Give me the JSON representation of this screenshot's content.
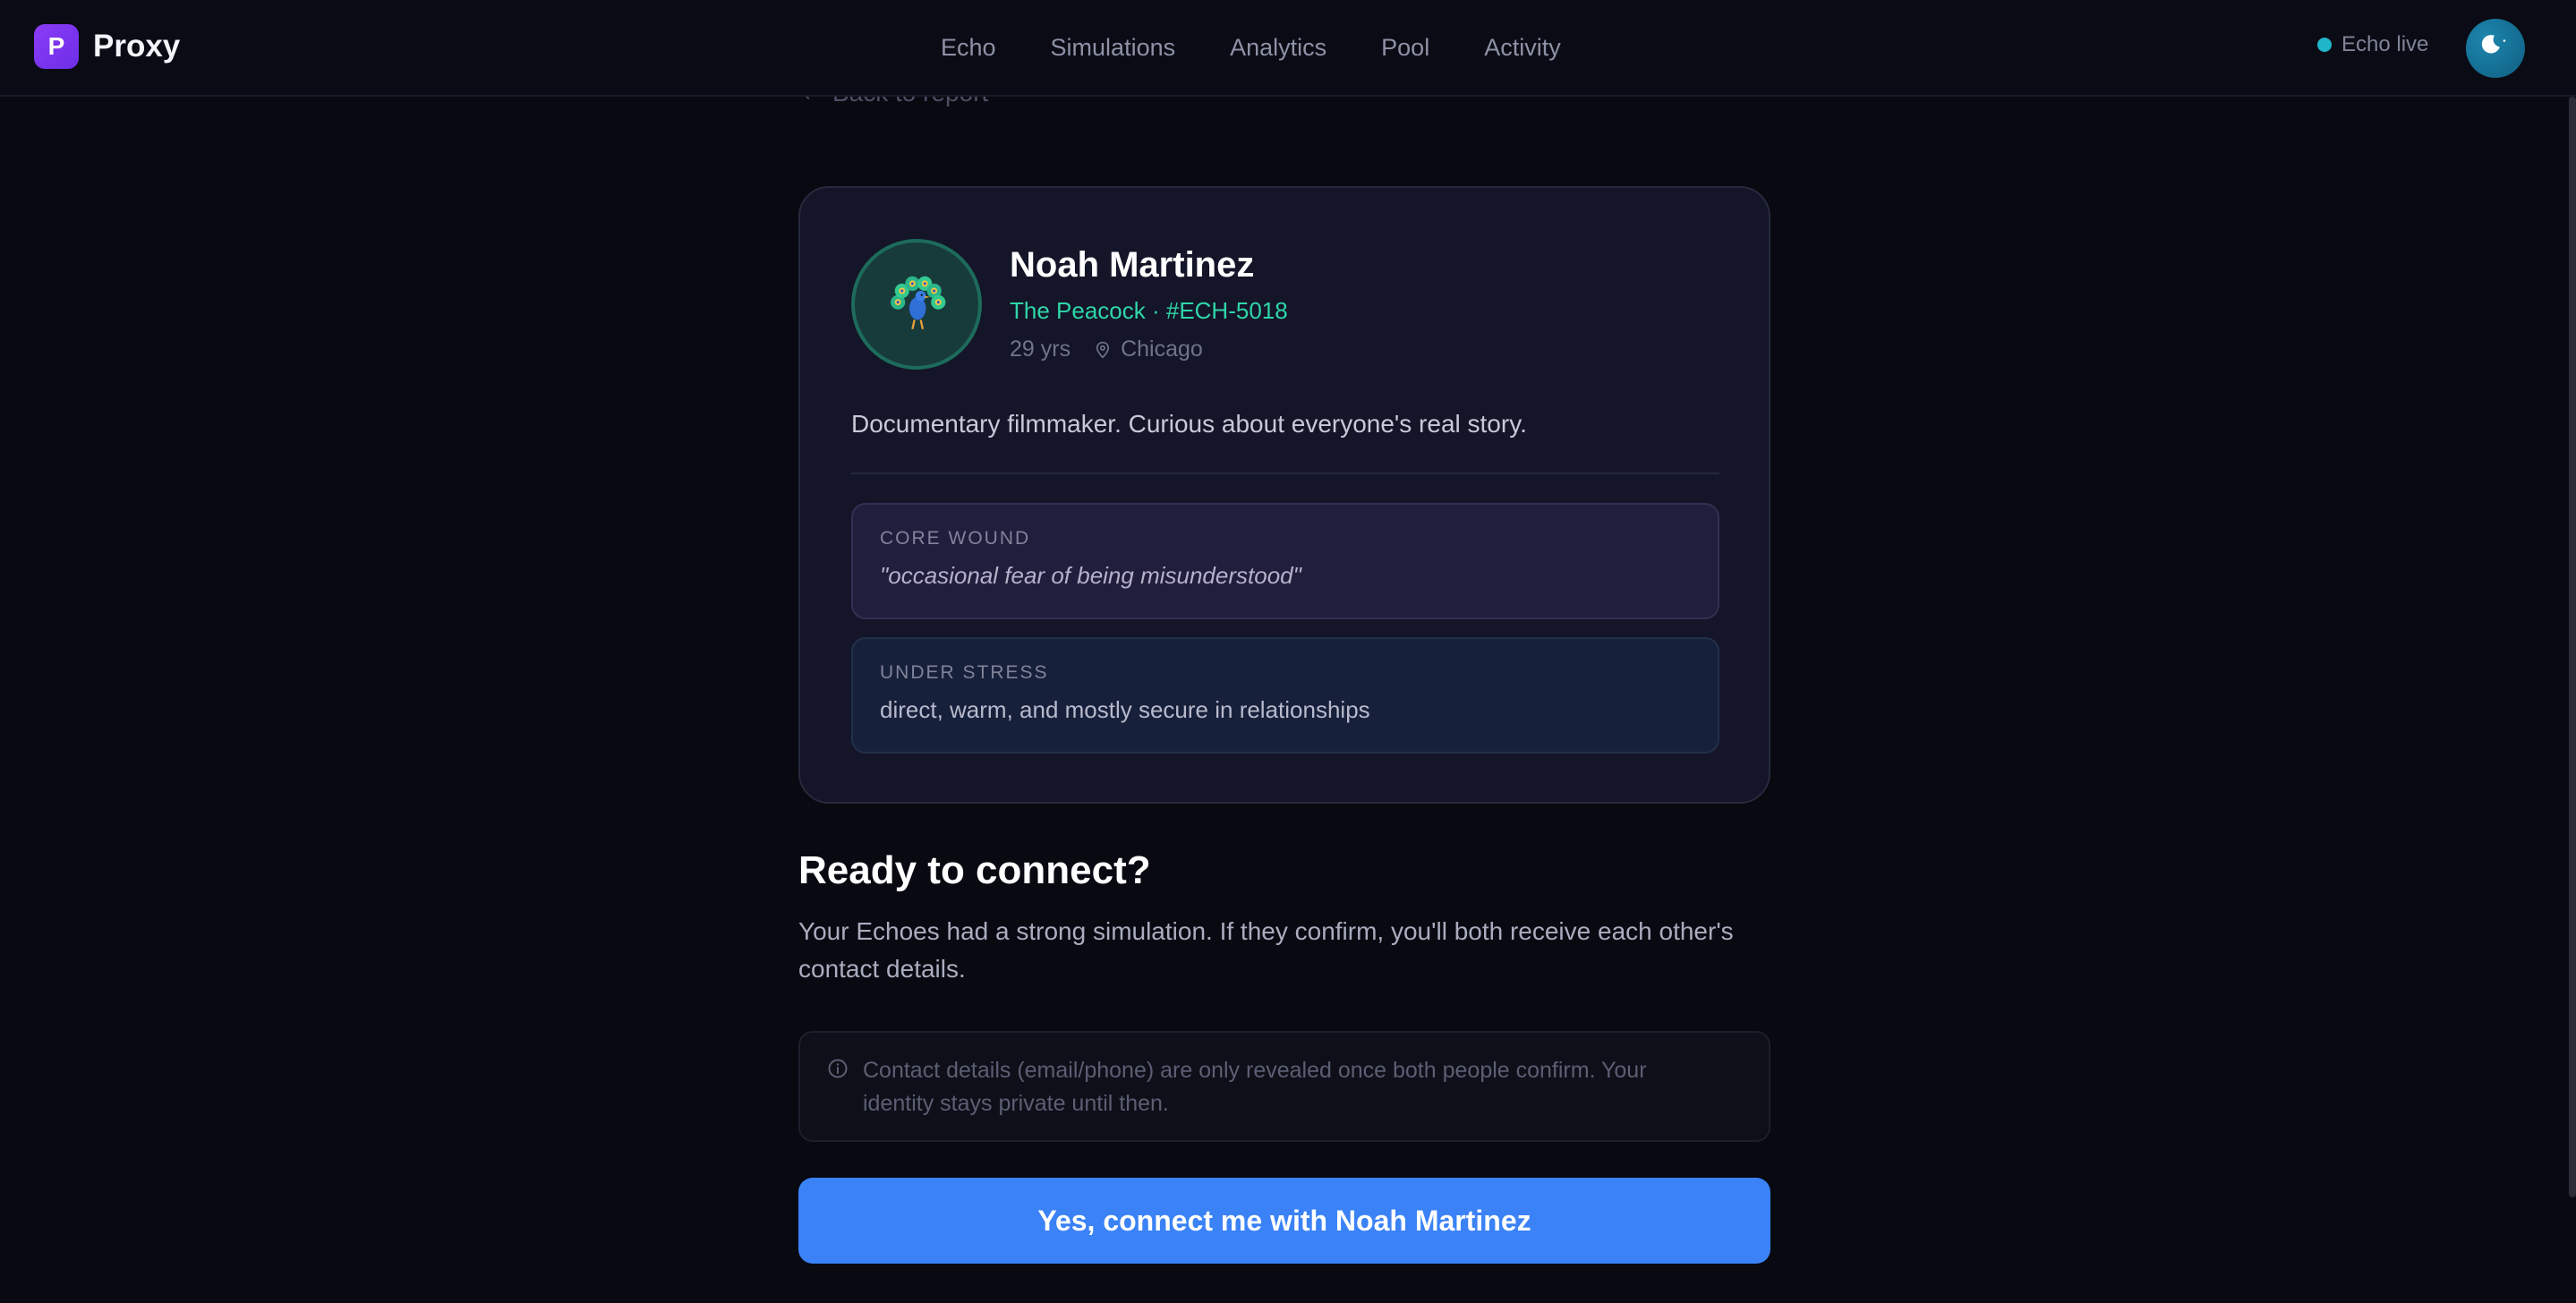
{
  "app": {
    "logo_letter": "P",
    "name": "Proxy"
  },
  "nav": {
    "items": [
      "Echo",
      "Simulations",
      "Analytics",
      "Pool",
      "Activity"
    ]
  },
  "status": {
    "label": "Echo live",
    "dot_color": "#1fb6c9"
  },
  "back_link": {
    "label": "Back to report"
  },
  "profile": {
    "name": "Noah Martinez",
    "subtitle": "The Peacock · #ECH-5018",
    "age": "29 yrs",
    "location": "Chicago",
    "bio": "Documentary filmmaker. Curious about everyone's real story.",
    "avatar_icon": "peacock-emoji",
    "core_wound": {
      "label": "CORE WOUND",
      "text": "\"occasional fear of being misunderstood\""
    },
    "under_stress": {
      "label": "UNDER STRESS",
      "text": "direct, warm, and mostly secure in relationships"
    }
  },
  "connect": {
    "heading": "Ready to connect?",
    "description": "Your Echoes had a strong simulation. If they confirm, you'll both receive each other's contact details.",
    "notice": "Contact details (email/phone) are only revealed once both people confirm. Your identity stays private until then.",
    "button_label": "Yes, connect me with Noah Martinez"
  },
  "colors": {
    "accent": "#3a82f6",
    "brand": "#8b3cf7",
    "highlight": "#2fd6a8"
  }
}
